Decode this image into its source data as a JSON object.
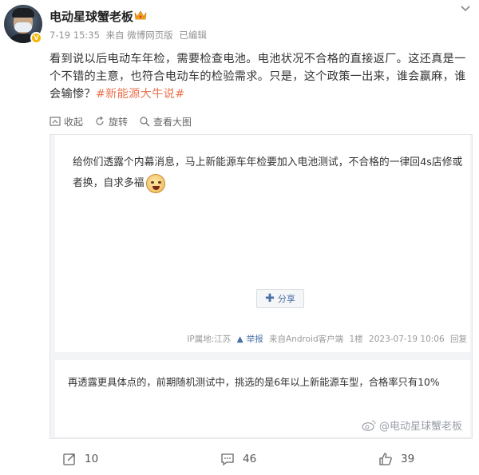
{
  "post": {
    "username": "电动星球蟹老板",
    "meta": {
      "time": "7-19 15:35",
      "source": "来自 微博网页版",
      "edited": "已编辑"
    },
    "text": "看到说以后电动车年检，需要检查电池。电池状况不合格的直接返厂。这还真是一个不错的主意，也符合电动车的检验需求。只是，这个政策一出来，谁会赢麻，谁会输惨？",
    "hashtag": "#新能源大牛说#"
  },
  "toolbar": {
    "collect_label": "收起",
    "rotate_label": "旋转",
    "view_label": "查看大图"
  },
  "embed": {
    "card1": {
      "text": "给你们透露个内幕消息，马上新能源车年检要加入电池测试，不合格的一律回4s店修或者换，自求多福",
      "share_label": "分享",
      "meta": {
        "ip": "IP属地:江苏",
        "report": "举报",
        "source": "来自Android客户端",
        "floor": "1楼",
        "time": "2023-07-19 10:06",
        "reply": "回复"
      }
    },
    "card2": {
      "text": "再透露更具体点的，前期随机测试中，挑选的是6年以上新能源车型，合格率只有10%"
    },
    "watermark": "@电动星球蟹老板"
  },
  "footer": {
    "reposts": "10",
    "comments": "46",
    "likes": "39"
  },
  "colors": {
    "hashtag": "#eb7350",
    "link": "#4a6fa5",
    "meta": "#939393"
  }
}
